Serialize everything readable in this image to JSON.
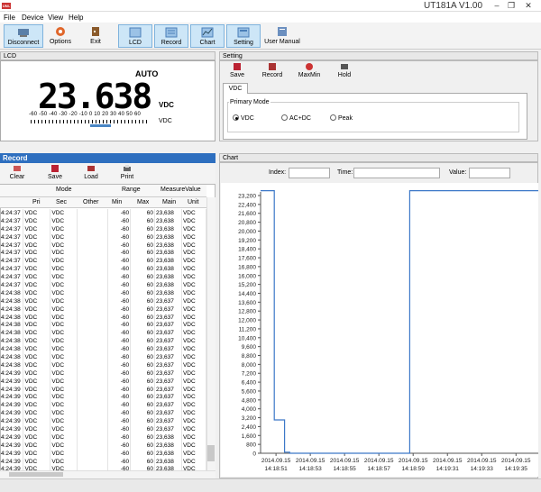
{
  "window": {
    "title": "UT181A V1.00",
    "icon_text": "UNI-T",
    "min": "–",
    "restore": "❐",
    "close": "✕"
  },
  "menu": [
    "File",
    "Device",
    "View",
    "Help"
  ],
  "toolbar": {
    "buttons": [
      "Disconnect",
      "Options",
      "Exit",
      "LCD",
      "Record",
      "Chart",
      "Setting",
      "User Manual"
    ]
  },
  "lcd": {
    "title": "LCD",
    "mode": "AUTO",
    "reading": "23.638",
    "unit": "VDC",
    "sub_unit": "VDC",
    "bar_labels": "-60 -50 -40 -30 -20 -10  0  10  20  30  40  50  60",
    "bar_level": 0.39
  },
  "setting": {
    "title": "Setting",
    "buttons": [
      "Save",
      "Record",
      "MaxMin",
      "Hold"
    ],
    "tab": "VDC",
    "group": "Primary Mode",
    "options": [
      "VDC",
      "AC+DC",
      "Peak"
    ],
    "selected": "VDC"
  },
  "record": {
    "title": "Record",
    "buttons": [
      "Clear",
      "Save",
      "Load",
      "Print"
    ],
    "group_headers": [
      "Mode",
      "Range",
      "MeasureValue"
    ],
    "columns": [
      "Pri",
      "Sec",
      "Other",
      "Min",
      "Max",
      "Main",
      "Unit"
    ],
    "rows": [
      [
        "4:24:37",
        "VDC",
        "VDC",
        "",
        "-60",
        "60",
        "23,638",
        "VDC"
      ],
      [
        "4:24:37",
        "VDC",
        "VDC",
        "",
        "-60",
        "60",
        "23,638",
        "VDC"
      ],
      [
        "4:24:37",
        "VDC",
        "VDC",
        "",
        "-60",
        "60",
        "23,638",
        "VDC"
      ],
      [
        "4:24:37",
        "VDC",
        "VDC",
        "",
        "-60",
        "60",
        "23,638",
        "VDC"
      ],
      [
        "4:24:37",
        "VDC",
        "VDC",
        "",
        "-60",
        "60",
        "23,638",
        "VDC"
      ],
      [
        "4:24:37",
        "VDC",
        "VDC",
        "",
        "-60",
        "60",
        "23,638",
        "VDC"
      ],
      [
        "4:24:37",
        "VDC",
        "VDC",
        "",
        "-60",
        "60",
        "23,638",
        "VDC"
      ],
      [
        "4:24:37",
        "VDC",
        "VDC",
        "",
        "-60",
        "60",
        "23,638",
        "VDC"
      ],
      [
        "4:24:37",
        "VDC",
        "VDC",
        "",
        "-60",
        "60",
        "23,638",
        "VDC"
      ],
      [
        "4:24:37",
        "VDC",
        "VDC",
        "",
        "-60",
        "60",
        "23,638",
        "VDC"
      ],
      [
        "4:24:38",
        "VDC",
        "VDC",
        "",
        "-60",
        "60",
        "23,638",
        "VDC"
      ],
      [
        "4:24:38",
        "VDC",
        "VDC",
        "",
        "-60",
        "60",
        "23,637",
        "VDC"
      ],
      [
        "4:24:38",
        "VDC",
        "VDC",
        "",
        "-60",
        "60",
        "23,637",
        "VDC"
      ],
      [
        "4:24:38",
        "VDC",
        "VDC",
        "",
        "-60",
        "60",
        "23,637",
        "VDC"
      ],
      [
        "4:24:38",
        "VDC",
        "VDC",
        "",
        "-60",
        "60",
        "23,637",
        "VDC"
      ],
      [
        "4:24:38",
        "VDC",
        "VDC",
        "",
        "-60",
        "60",
        "23,637",
        "VDC"
      ],
      [
        "4:24:38",
        "VDC",
        "VDC",
        "",
        "-60",
        "60",
        "23,637",
        "VDC"
      ],
      [
        "4:24:38",
        "VDC",
        "VDC",
        "",
        "-60",
        "60",
        "23,637",
        "VDC"
      ],
      [
        "4:24:38",
        "VDC",
        "VDC",
        "",
        "-60",
        "60",
        "23,637",
        "VDC"
      ],
      [
        "4:24:38",
        "VDC",
        "VDC",
        "",
        "-60",
        "60",
        "23,637",
        "VDC"
      ],
      [
        "4:24:39",
        "VDC",
        "VDC",
        "",
        "-60",
        "60",
        "23,637",
        "VDC"
      ],
      [
        "4:24:39",
        "VDC",
        "VDC",
        "",
        "-60",
        "60",
        "23,637",
        "VDC"
      ],
      [
        "4:24:39",
        "VDC",
        "VDC",
        "",
        "-60",
        "60",
        "23,637",
        "VDC"
      ],
      [
        "4:24:39",
        "VDC",
        "VDC",
        "",
        "-60",
        "60",
        "23,637",
        "VDC"
      ],
      [
        "4:24:39",
        "VDC",
        "VDC",
        "",
        "-60",
        "60",
        "23,637",
        "VDC"
      ],
      [
        "4:24:39",
        "VDC",
        "VDC",
        "",
        "-60",
        "60",
        "23,637",
        "VDC"
      ],
      [
        "4:24:39",
        "VDC",
        "VDC",
        "",
        "-60",
        "60",
        "23,637",
        "VDC"
      ],
      [
        "4:24:39",
        "VDC",
        "VDC",
        "",
        "-60",
        "60",
        "23,637",
        "VDC"
      ],
      [
        "4:24:39",
        "VDC",
        "VDC",
        "",
        "-60",
        "60",
        "23,638",
        "VDC"
      ],
      [
        "4:24:39",
        "VDC",
        "VDC",
        "",
        "-60",
        "60",
        "23,638",
        "VDC"
      ],
      [
        "4:24:39",
        "VDC",
        "VDC",
        "",
        "-60",
        "60",
        "23,638",
        "VDC"
      ],
      [
        "4:24:39",
        "VDC",
        "VDC",
        "",
        "-60",
        "60",
        "23,638",
        "VDC"
      ],
      [
        "4:24:39",
        "VDC",
        "VDC",
        "",
        "-60",
        "60",
        "23,638",
        "VDC"
      ],
      [
        "4:24:39",
        "VDC",
        "VDC",
        "",
        "-60",
        "60",
        "23,638",
        "VDC"
      ]
    ],
    "selected_row": 33
  },
  "chart": {
    "title": "Chart",
    "index_label": "Index:",
    "time_label": "Time:",
    "value_label": "Value:",
    "index_value": "",
    "time_value": "",
    "value_value": ""
  },
  "chart_data": {
    "type": "line",
    "title": "",
    "xlabel": "",
    "ylabel": "",
    "ylim": [
      0,
      23200
    ],
    "yticks": [
      0,
      800,
      1600,
      2400,
      3200,
      4000,
      4800,
      5600,
      6400,
      7200,
      8000,
      8800,
      9600,
      10400,
      11200,
      12000,
      12800,
      13600,
      14400,
      15200,
      16000,
      16800,
      17600,
      18400,
      19200,
      20000,
      20800,
      21600,
      22400,
      23200
    ],
    "ytick_labels": [
      "0",
      "800",
      "1,600",
      "2,400",
      "3,200",
      "4,000",
      "4,800",
      "5,600",
      "6,400",
      "7,200",
      "8,000",
      "8,800",
      "9,600",
      "10,400",
      "11,200",
      "12,000",
      "12,800",
      "13,600",
      "14,400",
      "15,200",
      "16,000",
      "16,800",
      "17,600",
      "18,400",
      "19,200",
      "20,000",
      "20,800",
      "21,600",
      "22,400",
      "23,200"
    ],
    "xticks": [
      51,
      53,
      55,
      57,
      59,
      61,
      63,
      65
    ],
    "xtick_labels": [
      [
        "2014.09.15",
        "14:18:51"
      ],
      [
        "2014.09.15",
        "14:18:53"
      ],
      [
        "2014.09.15",
        "14:18:55"
      ],
      [
        "2014.09.15",
        "14:18:57"
      ],
      [
        "2014.09.15",
        "14:18:59"
      ],
      [
        "2014.09.15",
        "14:19:31"
      ],
      [
        "2014.09.15",
        "14:19:33"
      ],
      [
        "2014.09.15",
        "14:19:35"
      ]
    ],
    "xlim": [
      50.1,
      66.3
    ],
    "series": [
      {
        "name": "",
        "color": "#3c78c8",
        "x": [
          50.1,
          50.9,
          50.9,
          51.5,
          51.5,
          51.8,
          51.8,
          58.8,
          58.8,
          66.3
        ],
        "y": [
          23638,
          23638,
          3000,
          3000,
          100,
          100,
          0,
          0,
          23638,
          23638
        ]
      }
    ],
    "grid": false,
    "legend": "none"
  },
  "statusbar": {
    "text": ""
  }
}
